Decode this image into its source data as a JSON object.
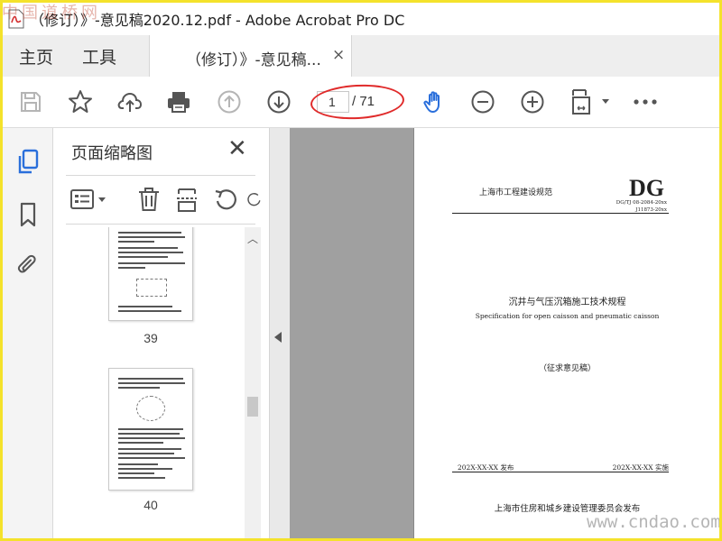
{
  "window": {
    "title": "（修订）》-意见稿2020.12.pdf - Adobe Acrobat Pro DC"
  },
  "nav": {
    "home_label": "主页",
    "tools_label": "工具"
  },
  "doc_tab": {
    "label": "（修订）》-意见稿...",
    "close_glyph": "×"
  },
  "toolbar": {
    "current_page": "1",
    "total_pages": "/ 71"
  },
  "thumbnail_panel": {
    "title": "页面缩略图",
    "close_glyph": "✕",
    "thumbnails": [
      {
        "label": "39"
      },
      {
        "label": "40"
      }
    ]
  },
  "page_content": {
    "org_line": "上海市工程建设规范",
    "standard_mark": "DG",
    "code_line1": "DG/TJ 08-2084-20xx",
    "code_line2": "J11873-20xx",
    "title_cn": "沉井与气压沉箱施工技术规程",
    "title_en": "Specification for open caisson and pneumatic caisson",
    "draft_note": "（征求意见稿）",
    "issue_date": "202X-XX-XX 发布",
    "impl_date": "202X-XX-XX 实施",
    "publisher": "上海市住房和城乡建设管理委员会发布"
  },
  "watermarks": {
    "top": "中国道桥网",
    "bottom": "www.cndao.com"
  },
  "colors": {
    "frame": "#f4e22b",
    "highlight": "#e02a2a",
    "hand_tool": "#2a6fdb",
    "active_rail": "#2a6fdb"
  }
}
